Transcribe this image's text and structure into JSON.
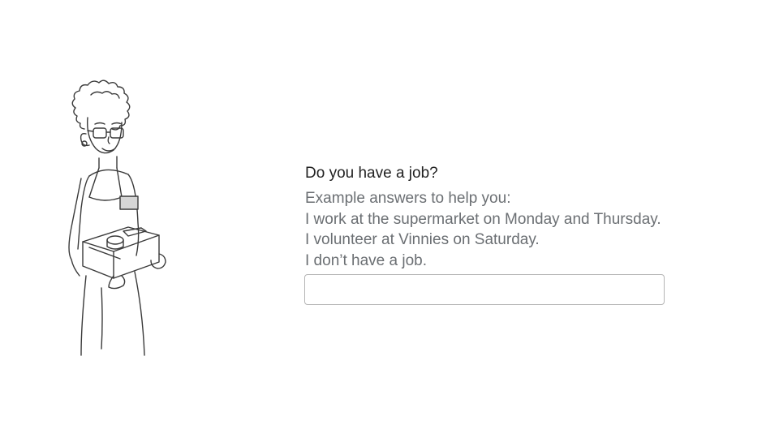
{
  "form": {
    "question": "Do you have a job?",
    "hint_lines": [
      "Example answers to help you:",
      "I work at the supermarket on Monday and Thursday.",
      "I volunteer at Vinnies on Saturday.",
      "I don’t have a job."
    ],
    "answer_value": "",
    "answer_placeholder": ""
  },
  "illustration": {
    "icon": "woman-holding-box-illustration",
    "stroke_color": "#3a3a3a",
    "badge_color": "#d6d6d6"
  }
}
